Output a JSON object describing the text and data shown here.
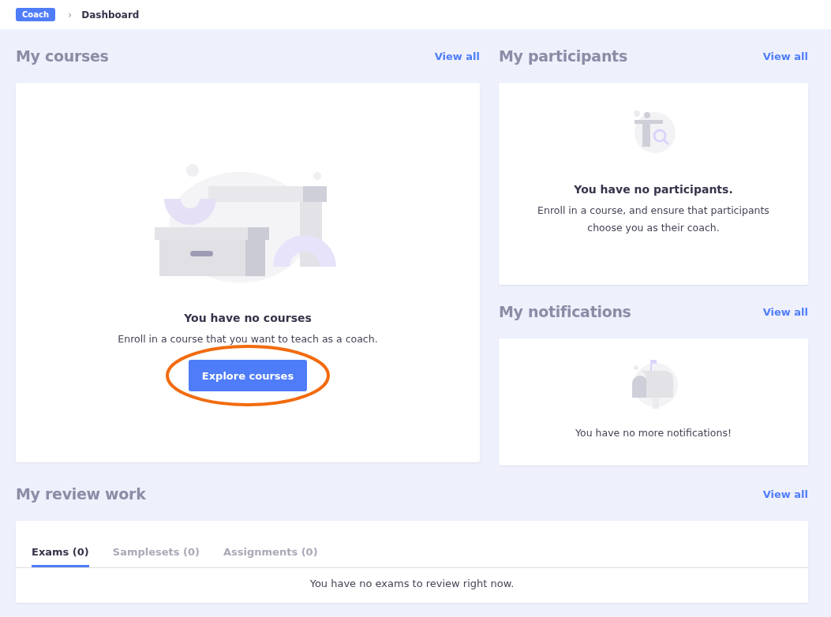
{
  "breadcrumb": {
    "badge": "Coach",
    "separator": "›",
    "current": "Dashboard"
  },
  "courses": {
    "title": "My courses",
    "view_all": "View all",
    "empty_title": "You have no courses",
    "empty_text": "Enroll in a course that you want to teach as a coach.",
    "button": "Explore courses"
  },
  "participants": {
    "title": "My participants",
    "view_all": "View all",
    "empty_title": "You have no participants.",
    "empty_text": "Enroll in a course, and ensure that participants choose you as their coach."
  },
  "notifications": {
    "title": "My notifications",
    "view_all": "View all",
    "empty_text": "You have no more notifications!"
  },
  "review": {
    "title": "My review work",
    "view_all": "View all",
    "tabs": [
      {
        "label": "Exams (0)",
        "selected": true
      },
      {
        "label": "Samplesets (0)",
        "selected": false
      },
      {
        "label": "Assignments (0)",
        "selected": false
      }
    ],
    "empty_text": "You have no exams to review right now."
  }
}
